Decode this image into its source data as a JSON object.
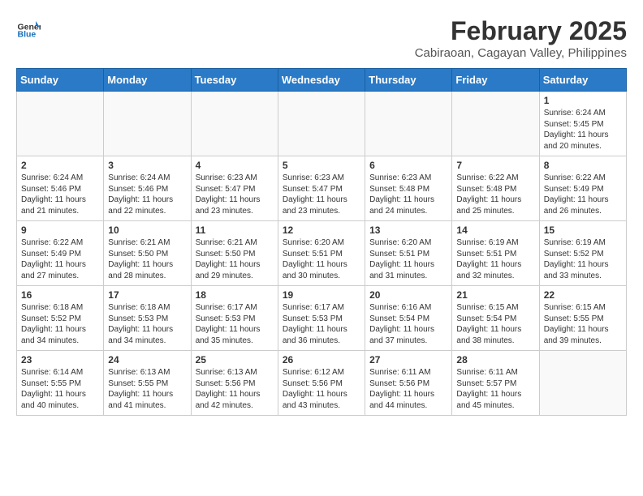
{
  "header": {
    "logo_general": "General",
    "logo_blue": "Blue",
    "month_year": "February 2025",
    "location": "Cabiraoan, Cagayan Valley, Philippines"
  },
  "days_of_week": [
    "Sunday",
    "Monday",
    "Tuesday",
    "Wednesday",
    "Thursday",
    "Friday",
    "Saturday"
  ],
  "weeks": [
    [
      {
        "day": "",
        "info": ""
      },
      {
        "day": "",
        "info": ""
      },
      {
        "day": "",
        "info": ""
      },
      {
        "day": "",
        "info": ""
      },
      {
        "day": "",
        "info": ""
      },
      {
        "day": "",
        "info": ""
      },
      {
        "day": "1",
        "info": "Sunrise: 6:24 AM\nSunset: 5:45 PM\nDaylight: 11 hours\nand 20 minutes."
      }
    ],
    [
      {
        "day": "2",
        "info": "Sunrise: 6:24 AM\nSunset: 5:46 PM\nDaylight: 11 hours\nand 21 minutes."
      },
      {
        "day": "3",
        "info": "Sunrise: 6:24 AM\nSunset: 5:46 PM\nDaylight: 11 hours\nand 22 minutes."
      },
      {
        "day": "4",
        "info": "Sunrise: 6:23 AM\nSunset: 5:47 PM\nDaylight: 11 hours\nand 23 minutes."
      },
      {
        "day": "5",
        "info": "Sunrise: 6:23 AM\nSunset: 5:47 PM\nDaylight: 11 hours\nand 23 minutes."
      },
      {
        "day": "6",
        "info": "Sunrise: 6:23 AM\nSunset: 5:48 PM\nDaylight: 11 hours\nand 24 minutes."
      },
      {
        "day": "7",
        "info": "Sunrise: 6:22 AM\nSunset: 5:48 PM\nDaylight: 11 hours\nand 25 minutes."
      },
      {
        "day": "8",
        "info": "Sunrise: 6:22 AM\nSunset: 5:49 PM\nDaylight: 11 hours\nand 26 minutes."
      }
    ],
    [
      {
        "day": "9",
        "info": "Sunrise: 6:22 AM\nSunset: 5:49 PM\nDaylight: 11 hours\nand 27 minutes."
      },
      {
        "day": "10",
        "info": "Sunrise: 6:21 AM\nSunset: 5:50 PM\nDaylight: 11 hours\nand 28 minutes."
      },
      {
        "day": "11",
        "info": "Sunrise: 6:21 AM\nSunset: 5:50 PM\nDaylight: 11 hours\nand 29 minutes."
      },
      {
        "day": "12",
        "info": "Sunrise: 6:20 AM\nSunset: 5:51 PM\nDaylight: 11 hours\nand 30 minutes."
      },
      {
        "day": "13",
        "info": "Sunrise: 6:20 AM\nSunset: 5:51 PM\nDaylight: 11 hours\nand 31 minutes."
      },
      {
        "day": "14",
        "info": "Sunrise: 6:19 AM\nSunset: 5:51 PM\nDaylight: 11 hours\nand 32 minutes."
      },
      {
        "day": "15",
        "info": "Sunrise: 6:19 AM\nSunset: 5:52 PM\nDaylight: 11 hours\nand 33 minutes."
      }
    ],
    [
      {
        "day": "16",
        "info": "Sunrise: 6:18 AM\nSunset: 5:52 PM\nDaylight: 11 hours\nand 34 minutes."
      },
      {
        "day": "17",
        "info": "Sunrise: 6:18 AM\nSunset: 5:53 PM\nDaylight: 11 hours\nand 34 minutes."
      },
      {
        "day": "18",
        "info": "Sunrise: 6:17 AM\nSunset: 5:53 PM\nDaylight: 11 hours\nand 35 minutes."
      },
      {
        "day": "19",
        "info": "Sunrise: 6:17 AM\nSunset: 5:53 PM\nDaylight: 11 hours\nand 36 minutes."
      },
      {
        "day": "20",
        "info": "Sunrise: 6:16 AM\nSunset: 5:54 PM\nDaylight: 11 hours\nand 37 minutes."
      },
      {
        "day": "21",
        "info": "Sunrise: 6:15 AM\nSunset: 5:54 PM\nDaylight: 11 hours\nand 38 minutes."
      },
      {
        "day": "22",
        "info": "Sunrise: 6:15 AM\nSunset: 5:55 PM\nDaylight: 11 hours\nand 39 minutes."
      }
    ],
    [
      {
        "day": "23",
        "info": "Sunrise: 6:14 AM\nSunset: 5:55 PM\nDaylight: 11 hours\nand 40 minutes."
      },
      {
        "day": "24",
        "info": "Sunrise: 6:13 AM\nSunset: 5:55 PM\nDaylight: 11 hours\nand 41 minutes."
      },
      {
        "day": "25",
        "info": "Sunrise: 6:13 AM\nSunset: 5:56 PM\nDaylight: 11 hours\nand 42 minutes."
      },
      {
        "day": "26",
        "info": "Sunrise: 6:12 AM\nSunset: 5:56 PM\nDaylight: 11 hours\nand 43 minutes."
      },
      {
        "day": "27",
        "info": "Sunrise: 6:11 AM\nSunset: 5:56 PM\nDaylight: 11 hours\nand 44 minutes."
      },
      {
        "day": "28",
        "info": "Sunrise: 6:11 AM\nSunset: 5:57 PM\nDaylight: 11 hours\nand 45 minutes."
      },
      {
        "day": "",
        "info": ""
      }
    ]
  ]
}
